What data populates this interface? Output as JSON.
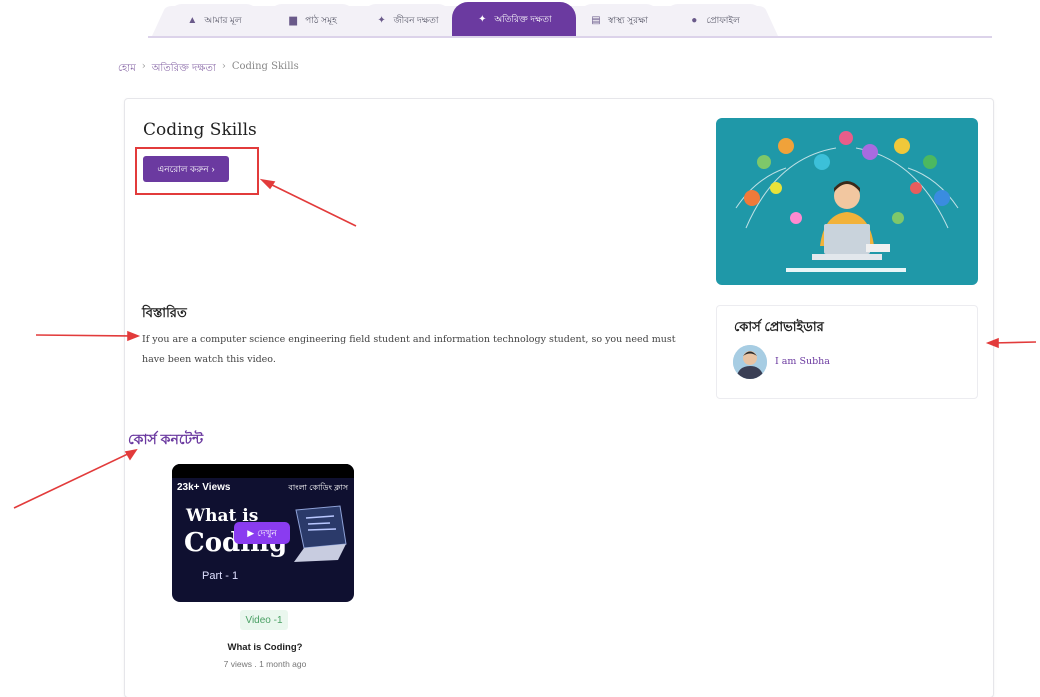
{
  "nav": {
    "tabs": [
      {
        "label": "আমার মূল",
        "icon": "home-icon",
        "active": false
      },
      {
        "label": "পাঠ সমূহ",
        "icon": "book-icon",
        "active": false
      },
      {
        "label": "জীবন দক্ষতা",
        "icon": "graduation-icon",
        "active": false
      },
      {
        "label": "অতিরিক্ত দক্ষতা",
        "icon": "graduation-icon",
        "active": true
      },
      {
        "label": "স্বাস্থ্য সুরক্ষা",
        "icon": "clipboard-icon",
        "active": false
      },
      {
        "label": "প্রোফাইল",
        "icon": "user-icon",
        "active": false
      }
    ],
    "accent": "#6b3aa0"
  },
  "breadcrumb": {
    "home": "হোম",
    "section": "অতিরিক্ত দক্ষতা",
    "current": "Coding Skills",
    "separator": "›"
  },
  "course": {
    "title": "Coding Skills",
    "enroll_label": "এনরোল করুন",
    "enroll_arrow": "›"
  },
  "description": {
    "heading": "বিস্তারিত",
    "text": "If you are a computer science engineering field student and information technology student, so you need must have been watch this video."
  },
  "content": {
    "heading": "কোর্স কনটেন্ট",
    "video": {
      "thumb_views": "23k+ Views",
      "thumb_tag": "বাংলা কোডিং ক্লাস",
      "thumb_line1": "What is",
      "thumb_line2": "Coding",
      "thumb_part": "Part - 1",
      "play_label": "দেখুন",
      "badge": "Video -1",
      "title": "What is Coding?",
      "meta": "7 views . 1 month ago"
    }
  },
  "instructor": {
    "heading": "কোর্স প্রোভাইডার",
    "name": "I am Subha"
  }
}
